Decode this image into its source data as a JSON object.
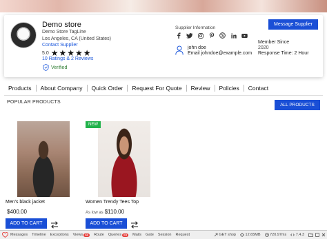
{
  "store": {
    "name": "Demo store",
    "tagline": "Demo Store TagLine",
    "location": "Los Angeles, CA (United States)",
    "contact_link": "Contact Supplier",
    "rating_value": "5.0",
    "stars": 5,
    "reviews_link": "10 Ratings & 2 Reviews",
    "verified": "Verified"
  },
  "supplier": {
    "info_label": "Supplier Information",
    "socials": [
      "facebook-icon",
      "twitter-icon",
      "instagram-icon",
      "pinterest-icon",
      "skype-icon",
      "linkedin-icon",
      "youtube-icon"
    ],
    "user_name": "john doe",
    "user_email": "Email johndoe@example.com",
    "message_button": "Message Supplier",
    "member_since_label": "Member Since",
    "member_since_value": "2020",
    "response_time": "Response Time: 2 Hour"
  },
  "tabs": [
    "Products",
    "About Company",
    "Quick Order",
    "Request For Quote",
    "Review",
    "Policies",
    "Contact"
  ],
  "popular": {
    "heading": "POPULAR PRODUCTS",
    "all_button": "ALL PRODUCTS"
  },
  "products": [
    {
      "name": "Men's black jacket",
      "price_prefix": "",
      "price": "$400.00",
      "badge": "",
      "cart": "ADD TO CART"
    },
    {
      "name": "Women Trendy Tees Top",
      "price_prefix": "As low as",
      "price": "$110.00",
      "badge": "NEW",
      "cart": "ADD TO CART"
    }
  ],
  "debugbar": {
    "items": [
      {
        "label": "Messages",
        "badge": ""
      },
      {
        "label": "Timeline",
        "badge": ""
      },
      {
        "label": "Exceptions",
        "badge": ""
      },
      {
        "label": "Views",
        "badge": "96"
      },
      {
        "label": "Route",
        "badge": ""
      },
      {
        "label": "Queries",
        "badge": "93"
      },
      {
        "label": "Mails",
        "badge": ""
      },
      {
        "label": "Gate",
        "badge": ""
      },
      {
        "label": "Session",
        "badge": ""
      },
      {
        "label": "Request",
        "badge": ""
      }
    ],
    "method": "GET shop",
    "memory": "12.65MB",
    "time": "720.97ms",
    "version": "7.4.3"
  },
  "colors": {
    "accent": "#1a4fd6",
    "link": "#1a56db",
    "verified": "#2e7d32",
    "new_badge": "#21b24b",
    "debug_badge": "#e53935"
  }
}
